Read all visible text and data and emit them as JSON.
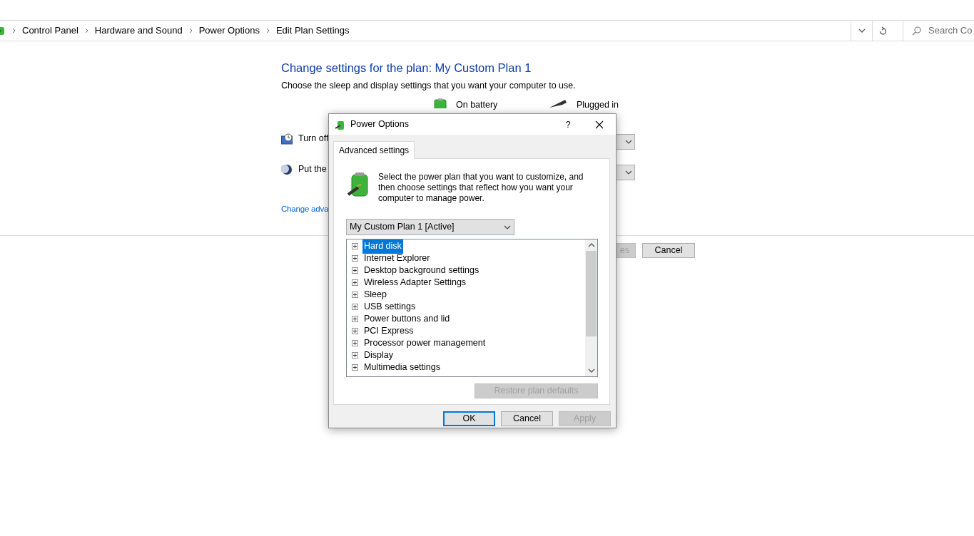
{
  "address_bar": {
    "breadcrumb": [
      "Control Panel",
      "Hardware and Sound",
      "Power Options",
      "Edit Plan Settings"
    ],
    "search": {
      "placeholder": "Search Co"
    }
  },
  "page": {
    "title": "Change settings for the plan: My Custom Plan 1",
    "subtitle": "Choose the sleep and display settings that you want your computer to use.",
    "columns": [
      "On battery",
      "Plugged in"
    ],
    "settings": [
      "Turn off",
      "Put the"
    ],
    "link": "Change adva",
    "buttons": [
      {
        "label": "es",
        "disabled": true
      },
      {
        "label": "Cancel",
        "disabled": false
      }
    ]
  },
  "dialog": {
    "title": "Power Options",
    "help": "?",
    "tabs": [
      {
        "label": "Advanced settings",
        "selected": true
      }
    ],
    "intro": "Select the power plan that you want to customize, and then choose settings that reflect how you want your computer to manage power.",
    "plan": "My Custom Plan 1 [Active]",
    "tree": [
      {
        "label": "Hard disk",
        "selected": true
      },
      {
        "label": "Internet Explorer",
        "selected": false
      },
      {
        "label": "Desktop background settings",
        "selected": false
      },
      {
        "label": "Wireless Adapter Settings",
        "selected": false
      },
      {
        "label": "Sleep",
        "selected": false
      },
      {
        "label": "USB settings",
        "selected": false
      },
      {
        "label": "Power buttons and lid",
        "selected": false
      },
      {
        "label": "PCI Express",
        "selected": false
      },
      {
        "label": "Processor power management",
        "selected": false
      },
      {
        "label": "Display",
        "selected": false
      },
      {
        "label": "Multimedia settings",
        "selected": false
      }
    ],
    "restore": {
      "label": "Restore plan defaults",
      "disabled": true
    },
    "buttons": [
      {
        "label": "OK",
        "default": true,
        "disabled": false
      },
      {
        "label": "Cancel",
        "default": false,
        "disabled": false
      },
      {
        "label": "Apply",
        "default": false,
        "disabled": true
      }
    ]
  }
}
